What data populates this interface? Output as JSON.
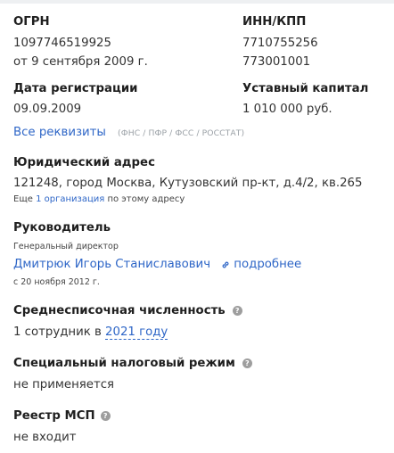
{
  "ogrn": {
    "label": "ОГРН",
    "value": "1097746519925",
    "date": "от 9 сентября 2009 г."
  },
  "inn_kpp": {
    "label": "ИНН/КПП",
    "inn": "7710755256",
    "kpp": "773001001"
  },
  "registration": {
    "label": "Дата регистрации",
    "value": "09.09.2009"
  },
  "capital": {
    "label": "Уставный капитал",
    "value": "1 010 000 руб."
  },
  "requisites": {
    "link": "Все реквизиты",
    "note": "(ФНС / ПФР / ФСС / РОССТАТ)"
  },
  "address": {
    "label": "Юридический адрес",
    "value": "121248, город Москва, Кутузовский пр-кт, д.4/2, кв.265",
    "more_prefix": "Еще",
    "more_link": "1 организация",
    "more_suffix": "по этому адресу"
  },
  "head": {
    "label": "Руководитель",
    "position": "Генеральный директор",
    "name": "Дмитрюк Игорь Станиславович",
    "details_link": "подробнее",
    "since": "с 20 ноября 2012 г."
  },
  "headcount": {
    "label": "Среднесписочная численность",
    "value_prefix": "1 сотрудник в",
    "year_link": "2021 году",
    "help": "?"
  },
  "tax_regime": {
    "label": "Специальный налоговый режим",
    "value": "не применяется",
    "help": "?"
  },
  "msp": {
    "label": "Реестр МСП",
    "value": "не входит",
    "help": "?"
  },
  "colors": {
    "link": "#2e66c7",
    "muted": "#9aa0a6",
    "help_icon": "#9e9e9e"
  }
}
